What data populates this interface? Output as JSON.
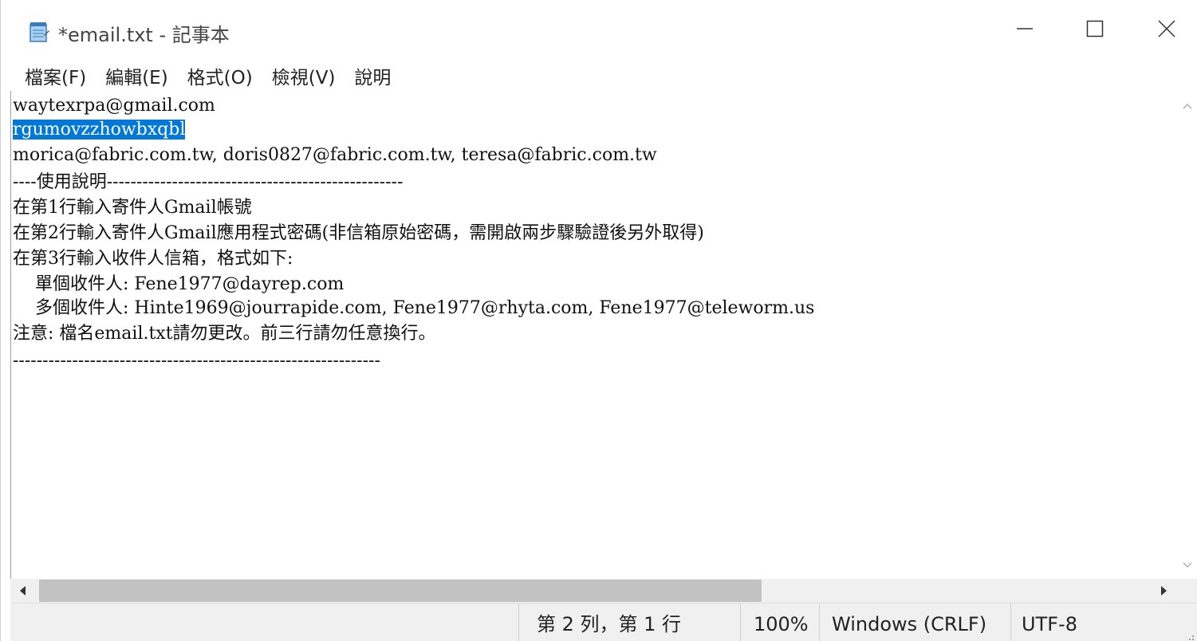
{
  "window": {
    "title": "*email.txt - 記事本",
    "app_icon": "notepad-icon",
    "controls": {
      "minimize_icon": "minimize-icon",
      "maximize_icon": "maximize-icon",
      "close_icon": "close-icon"
    }
  },
  "menubar": {
    "items": [
      "檔案(F)",
      "編輯(E)",
      "格式(O)",
      "檢視(V)",
      "說明"
    ]
  },
  "editor": {
    "lines": [
      "waytexrpa@gmail.com",
      "rgumovzzhowbxqbl",
      "morica@fabric.com.tw, doris0827@fabric.com.tw, teresa@fabric.com.tw",
      "----使用說明--------------------------------------------------",
      "在第1行輸入寄件人Gmail帳號",
      "在第2行輸入寄件人Gmail應用程式密碼(非信箱原始密碼，需開啟兩步驟驗證後另外取得)",
      "在第3行輸入收件人信箱，格式如下:",
      "    單個收件人: Fene1977@dayrep.com",
      "    多個收件人: Hinte1969@jourrapide.com, Fene1977@rhyta.com, Fene1977@teleworm.us",
      "注意: 檔名email.txt請勿更改。前三行請勿任意換行。",
      "",
      "--------------------------------------------------------------"
    ],
    "selected_line_index": 1
  },
  "scrollbars": {
    "up_icon": "scroll-up-icon",
    "down_icon": "scroll-down-icon",
    "left_icon": "scroll-left-icon",
    "right_icon": "scroll-right-icon"
  },
  "statusbar": {
    "position": "第 2 列，第 1 行",
    "zoom": "100%",
    "line_ending": "Windows (CRLF)",
    "encoding": "UTF-8"
  },
  "colors": {
    "selection": "#0078d7",
    "statusbar_bg": "#f0f0f0"
  }
}
